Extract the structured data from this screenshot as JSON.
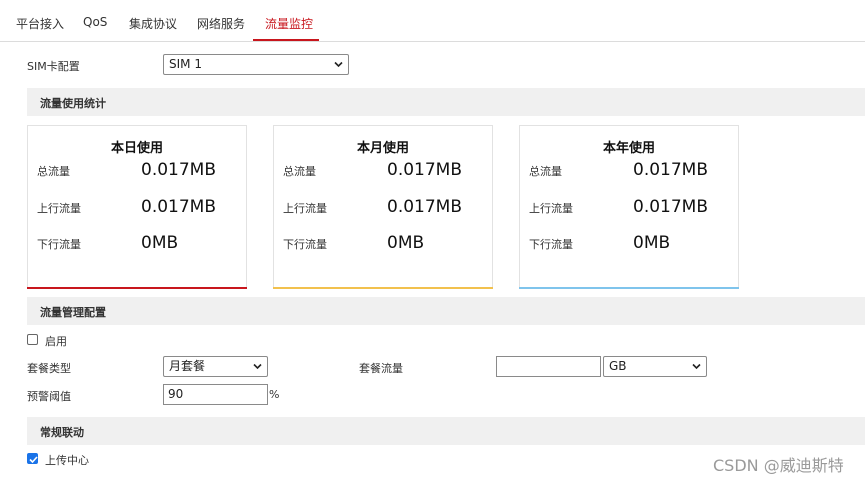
{
  "tabs": [
    {
      "label": "平台接入"
    },
    {
      "label": "QoS"
    },
    {
      "label": "集成协议"
    },
    {
      "label": "网络服务"
    },
    {
      "label": "流量监控",
      "active": true
    }
  ],
  "sim": {
    "label": "SIM卡配置",
    "selected": "SIM 1"
  },
  "stats_section": {
    "title": "流量使用统计"
  },
  "cards": [
    {
      "title": "本日使用",
      "total_label": "总流量",
      "total_value": "0.017MB",
      "up_label": "上行流量",
      "up_value": "0.017MB",
      "down_label": "下行流量",
      "down_value": "0MB",
      "accent": "#c8161d"
    },
    {
      "title": "本月使用",
      "total_label": "总流量",
      "total_value": "0.017MB",
      "up_label": "上行流量",
      "up_value": "0.017MB",
      "down_label": "下行流量",
      "down_value": "0MB",
      "accent": "#f2c14e"
    },
    {
      "title": "本年使用",
      "total_label": "总流量",
      "total_value": "0.017MB",
      "up_label": "上行流量",
      "up_value": "0.017MB",
      "down_label": "下行流量",
      "down_value": "0MB",
      "accent": "#7fc4ec"
    }
  ],
  "mgmt_section": {
    "title": "流量管理配置"
  },
  "enable": {
    "label": "启用",
    "checked": false
  },
  "package_type": {
    "label": "套餐类型",
    "selected": "月套餐"
  },
  "package_flow": {
    "label": "套餐流量",
    "value": "",
    "unit_selected": "GB"
  },
  "warning": {
    "label": "预警阈值",
    "value": "90",
    "unit": "%"
  },
  "linkage_section": {
    "title": "常规联动"
  },
  "upload_center": {
    "label": "上传中心",
    "checked": true
  },
  "watermark": "CSDN @威迪斯特"
}
